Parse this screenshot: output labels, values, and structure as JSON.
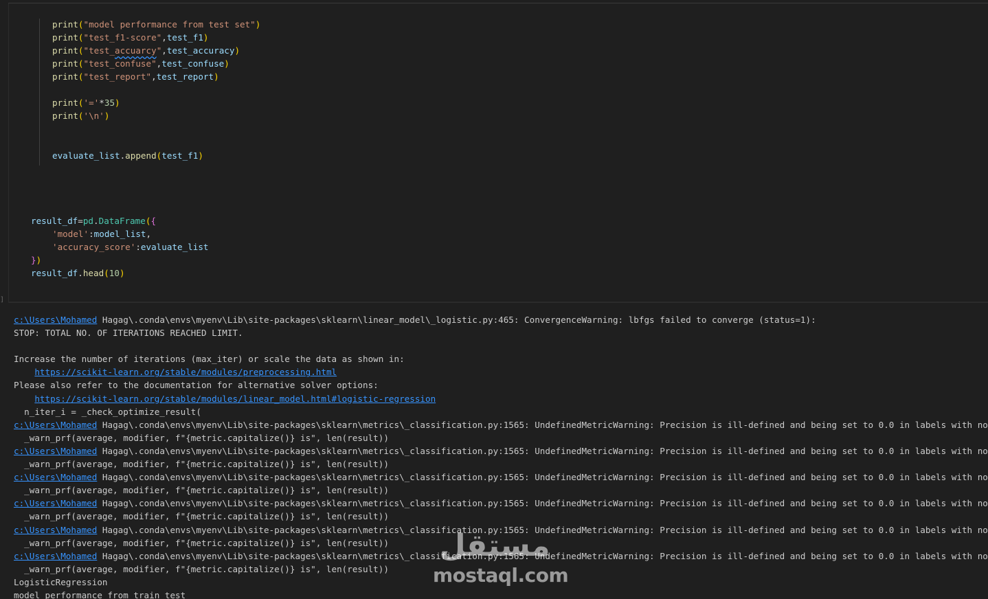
{
  "code_lines": [
    {
      "indent": "    ",
      "parts": [
        {
          "t": "print",
          "c": "fn"
        },
        {
          "t": "(",
          "c": "paren"
        },
        {
          "t": "\"model performance from test set\"",
          "c": "str"
        },
        {
          "t": ")",
          "c": "paren"
        }
      ]
    },
    {
      "indent": "    ",
      "parts": [
        {
          "t": "print",
          "c": "fn"
        },
        {
          "t": "(",
          "c": "paren"
        },
        {
          "t": "\"test_f1-score\"",
          "c": "str"
        },
        {
          "t": ",",
          "c": "punc"
        },
        {
          "t": "test_f1",
          "c": "var"
        },
        {
          "t": ")",
          "c": "paren"
        }
      ]
    },
    {
      "indent": "    ",
      "parts": [
        {
          "t": "print",
          "c": "fn"
        },
        {
          "t": "(",
          "c": "paren"
        },
        {
          "t": "\"test_",
          "c": "str"
        },
        {
          "t": "accuarcy",
          "c": "str squiggle"
        },
        {
          "t": "\"",
          "c": "str"
        },
        {
          "t": ",",
          "c": "punc"
        },
        {
          "t": "test_accuracy",
          "c": "var"
        },
        {
          "t": ")",
          "c": "paren"
        }
      ]
    },
    {
      "indent": "    ",
      "parts": [
        {
          "t": "print",
          "c": "fn"
        },
        {
          "t": "(",
          "c": "paren"
        },
        {
          "t": "\"test_confuse\"",
          "c": "str"
        },
        {
          "t": ",",
          "c": "punc"
        },
        {
          "t": "test_confuse",
          "c": "var"
        },
        {
          "t": ")",
          "c": "paren"
        }
      ]
    },
    {
      "indent": "    ",
      "parts": [
        {
          "t": "print",
          "c": "fn"
        },
        {
          "t": "(",
          "c": "paren"
        },
        {
          "t": "\"test_report\"",
          "c": "str"
        },
        {
          "t": ",",
          "c": "punc"
        },
        {
          "t": "test_report",
          "c": "var"
        },
        {
          "t": ")",
          "c": "paren"
        }
      ]
    },
    {
      "indent": "",
      "parts": []
    },
    {
      "indent": "    ",
      "parts": [
        {
          "t": "print",
          "c": "fn"
        },
        {
          "t": "(",
          "c": "paren"
        },
        {
          "t": "'='",
          "c": "str"
        },
        {
          "t": "*",
          "c": "punc"
        },
        {
          "t": "35",
          "c": "num"
        },
        {
          "t": ")",
          "c": "paren"
        }
      ]
    },
    {
      "indent": "    ",
      "parts": [
        {
          "t": "print",
          "c": "fn"
        },
        {
          "t": "(",
          "c": "paren"
        },
        {
          "t": "'\\n'",
          "c": "str"
        },
        {
          "t": ")",
          "c": "paren"
        }
      ]
    },
    {
      "indent": "",
      "parts": []
    },
    {
      "indent": "",
      "parts": []
    },
    {
      "indent": "    ",
      "parts": [
        {
          "t": "evaluate_list",
          "c": "var"
        },
        {
          "t": ".",
          "c": "punc"
        },
        {
          "t": "append",
          "c": "fn"
        },
        {
          "t": "(",
          "c": "paren"
        },
        {
          "t": "test_f1",
          "c": "var"
        },
        {
          "t": ")",
          "c": "paren"
        }
      ]
    },
    {
      "indent": "",
      "parts": []
    },
    {
      "indent": "",
      "parts": []
    },
    {
      "indent": "",
      "parts": []
    },
    {
      "indent": "",
      "parts": []
    },
    {
      "indent": "",
      "parts": [
        {
          "t": "result_df",
          "c": "var"
        },
        {
          "t": "=",
          "c": "punc"
        },
        {
          "t": "pd",
          "c": "cls"
        },
        {
          "t": ".",
          "c": "punc"
        },
        {
          "t": "DataFrame",
          "c": "cls"
        },
        {
          "t": "(",
          "c": "paren"
        },
        {
          "t": "{",
          "c": "brace"
        }
      ]
    },
    {
      "indent": "    ",
      "parts": [
        {
          "t": "'model'",
          "c": "str"
        },
        {
          "t": ":",
          "c": "punc"
        },
        {
          "t": "model_list",
          "c": "var"
        },
        {
          "t": ",",
          "c": "punc"
        }
      ]
    },
    {
      "indent": "    ",
      "parts": [
        {
          "t": "'accuracy_score'",
          "c": "str"
        },
        {
          "t": ":",
          "c": "punc"
        },
        {
          "t": "evaluate_list",
          "c": "var"
        }
      ]
    },
    {
      "indent": "",
      "parts": [
        {
          "t": "}",
          "c": "brace"
        },
        {
          "t": ")",
          "c": "paren"
        }
      ]
    },
    {
      "indent": "",
      "parts": [
        {
          "t": "result_df",
          "c": "var"
        },
        {
          "t": ".",
          "c": "punc"
        },
        {
          "t": "head",
          "c": "fn"
        },
        {
          "t": "(",
          "c": "paren"
        },
        {
          "t": "10",
          "c": "num"
        },
        {
          "t": ")",
          "c": "paren"
        }
      ]
    }
  ],
  "output_lines": [
    {
      "link": "c:\\Users\\Mohamed",
      "text": " Hagag\\.conda\\envs\\myenv\\Lib\\site-packages\\sklearn\\linear_model\\_logistic.py:465: ConvergenceWarning: lbfgs failed to converge (status=1):"
    },
    {
      "text": "STOP: TOTAL NO. OF ITERATIONS REACHED LIMIT."
    },
    {
      "text": ""
    },
    {
      "text": "Increase the number of iterations (max_iter) or scale the data as shown in:"
    },
    {
      "prefix": "    ",
      "link": "https://scikit-learn.org/stable/modules/preprocessing.html",
      "text": ""
    },
    {
      "text": "Please also refer to the documentation for alternative solver options:"
    },
    {
      "prefix": "    ",
      "link": "https://scikit-learn.org/stable/modules/linear_model.html#logistic-regression",
      "text": ""
    },
    {
      "text": "  n_iter_i = _check_optimize_result("
    },
    {
      "link": "c:\\Users\\Mohamed",
      "text": " Hagag\\.conda\\envs\\myenv\\Lib\\site-packages\\sklearn\\metrics\\_classification.py:1565: UndefinedMetricWarning: Precision is ill-defined and being set to 0.0 in labels with no predicted samples."
    },
    {
      "text": "  _warn_prf(average, modifier, f\"{metric.capitalize()} is\", len(result))"
    },
    {
      "link": "c:\\Users\\Mohamed",
      "text": " Hagag\\.conda\\envs\\myenv\\Lib\\site-packages\\sklearn\\metrics\\_classification.py:1565: UndefinedMetricWarning: Precision is ill-defined and being set to 0.0 in labels with no predicted samples."
    },
    {
      "text": "  _warn_prf(average, modifier, f\"{metric.capitalize()} is\", len(result))"
    },
    {
      "link": "c:\\Users\\Mohamed",
      "text": " Hagag\\.conda\\envs\\myenv\\Lib\\site-packages\\sklearn\\metrics\\_classification.py:1565: UndefinedMetricWarning: Precision is ill-defined and being set to 0.0 in labels with no predicted samples."
    },
    {
      "text": "  _warn_prf(average, modifier, f\"{metric.capitalize()} is\", len(result))"
    },
    {
      "link": "c:\\Users\\Mohamed",
      "text": " Hagag\\.conda\\envs\\myenv\\Lib\\site-packages\\sklearn\\metrics\\_classification.py:1565: UndefinedMetricWarning: Precision is ill-defined and being set to 0.0 in labels with no predicted samples."
    },
    {
      "text": "  _warn_prf(average, modifier, f\"{metric.capitalize()} is\", len(result))"
    },
    {
      "link": "c:\\Users\\Mohamed",
      "text": " Hagag\\.conda\\envs\\myenv\\Lib\\site-packages\\sklearn\\metrics\\_classification.py:1565: UndefinedMetricWarning: Precision is ill-defined and being set to 0.0 in labels with no predicted samples."
    },
    {
      "text": "  _warn_prf(average, modifier, f\"{metric.capitalize()} is\", len(result))"
    },
    {
      "link": "c:\\Users\\Mohamed",
      "text": " Hagag\\.conda\\envs\\myenv\\Lib\\site-packages\\sklearn\\metrics\\_classification.py:1565: UndefinedMetricWarning: Precision is ill-defined and being set to 0.0 in labels with no predicted samples."
    },
    {
      "text": "  _warn_prf(average, modifier, f\"{metric.capitalize()} is\", len(result))"
    },
    {
      "text": "LogisticRegression"
    },
    {
      "text": "model performance from train test"
    }
  ],
  "watermark": {
    "arabic": "مستقل",
    "latin": "mostaql.com"
  }
}
